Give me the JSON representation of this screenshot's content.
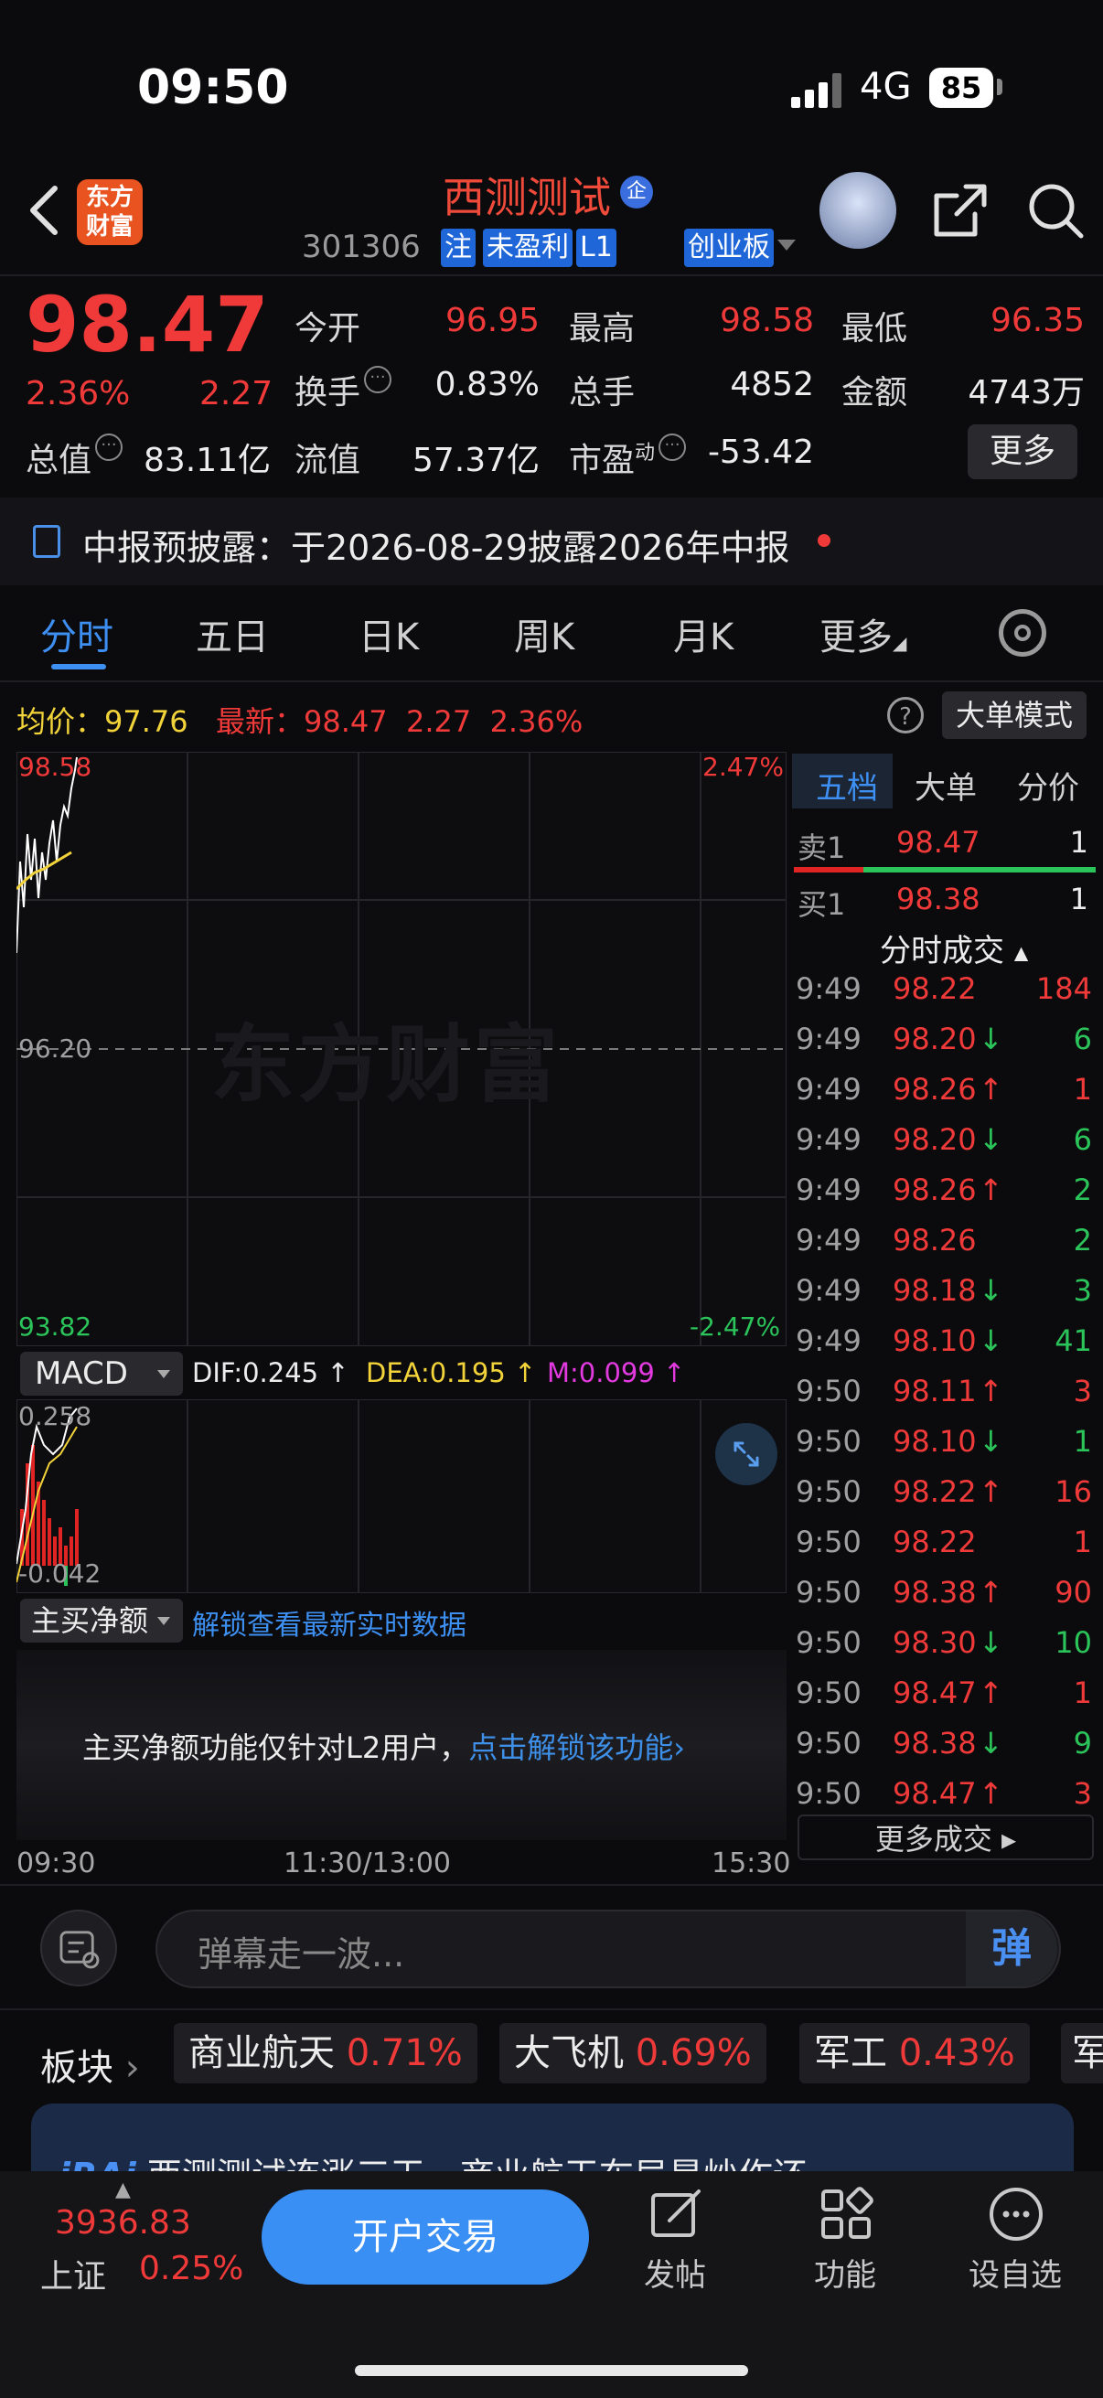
{
  "status": {
    "time": "09:50",
    "network": "4G",
    "battery": "85"
  },
  "header": {
    "logo_line1": "东方",
    "logo_line2": "财富",
    "stock_name": "西测测试",
    "badge": "企",
    "code": "301306",
    "tags": [
      "注",
      "未盈利",
      "L1"
    ],
    "board": "创业板"
  },
  "quote": {
    "price": "98.47",
    "change_pct": "2.36%",
    "change": "2.27",
    "open_label": "今开",
    "open": "96.95",
    "high_label": "最高",
    "high": "98.58",
    "low_label": "最低",
    "low": "96.35",
    "turnover_label": "换手",
    "turnover": "0.83%",
    "volume_label": "总手",
    "volume": "4852",
    "amount_label": "金额",
    "amount": "4743万",
    "mktcap_label": "总值",
    "mktcap": "83.11亿",
    "float_label": "流值",
    "float": "57.37亿",
    "pe_label": "市盈",
    "pe_sup": "动",
    "pe": "-53.42",
    "more": "更多"
  },
  "notice": {
    "text": "中报预披露：于2026-08-29披露2026年中报"
  },
  "tabs": [
    "分时",
    "五日",
    "日K",
    "周K",
    "月K",
    "更多"
  ],
  "chart_info": {
    "avg_label": "均价：",
    "avg": "97.76",
    "latest_label": "最新：",
    "latest": "98.47",
    "latest_chg": "2.27",
    "latest_pct": "2.36%",
    "help": "?",
    "big_order": "大单模式"
  },
  "chart_data": {
    "type": "line",
    "y_max": "98.58",
    "y_mid": "96.20",
    "y_min": "93.82",
    "pct_max": "2.47%",
    "pct_min": "-2.47%",
    "x_labels": [
      "09:30",
      "11:30/13:00",
      "15:30"
    ],
    "watermark": "东方财富",
    "macd": {
      "name": "MACD",
      "dif": "DIF:0.245 ↑",
      "dea": "DEA:0.195 ↑",
      "m": "M:0.099 ↑",
      "top": "0.258",
      "bottom": "-0.042"
    }
  },
  "net_buy": {
    "select": "主买净额",
    "link": "解锁查看最新实时数据",
    "msg": "主买净额功能仅针对L2用户，",
    "msg_link": "点击解锁该功能",
    "msg_chevron": "›"
  },
  "side": {
    "tabs": [
      "五档",
      "大单",
      "分价"
    ],
    "sell_label": "卖1",
    "sell_price": "98.47",
    "sell_vol": "1",
    "buy_label": "买1",
    "buy_price": "98.38",
    "buy_vol": "1",
    "trades_head": "分时成交",
    "trades": [
      {
        "t": "9:49",
        "p": "98.22",
        "d": "",
        "v": "184",
        "c": "red"
      },
      {
        "t": "9:49",
        "p": "98.20",
        "d": "↓",
        "v": "6",
        "c": "green"
      },
      {
        "t": "9:49",
        "p": "98.26",
        "d": "↑",
        "v": "1",
        "c": "red"
      },
      {
        "t": "9:49",
        "p": "98.20",
        "d": "↓",
        "v": "6",
        "c": "green"
      },
      {
        "t": "9:49",
        "p": "98.26",
        "d": "↑",
        "v": "2",
        "c": "green"
      },
      {
        "t": "9:49",
        "p": "98.26",
        "d": "",
        "v": "2",
        "c": "green"
      },
      {
        "t": "9:49",
        "p": "98.18",
        "d": "↓",
        "v": "3",
        "c": "green"
      },
      {
        "t": "9:49",
        "p": "98.10",
        "d": "↓",
        "v": "41",
        "c": "green"
      },
      {
        "t": "9:50",
        "p": "98.11",
        "d": "↑",
        "v": "3",
        "c": "red"
      },
      {
        "t": "9:50",
        "p": "98.10",
        "d": "↓",
        "v": "1",
        "c": "green"
      },
      {
        "t": "9:50",
        "p": "98.22",
        "d": "↑",
        "v": "16",
        "c": "red"
      },
      {
        "t": "9:50",
        "p": "98.22",
        "d": "",
        "v": "1",
        "c": "red"
      },
      {
        "t": "9:50",
        "p": "98.38",
        "d": "↑",
        "v": "90",
        "c": "red"
      },
      {
        "t": "9:50",
        "p": "98.30",
        "d": "↓",
        "v": "10",
        "c": "green"
      },
      {
        "t": "9:50",
        "p": "98.47",
        "d": "↑",
        "v": "1",
        "c": "red"
      },
      {
        "t": "9:50",
        "p": "98.38",
        "d": "↓",
        "v": "9",
        "c": "green"
      },
      {
        "t": "9:50",
        "p": "98.47",
        "d": "↑",
        "v": "3",
        "c": "red"
      }
    ],
    "more_trades": "更多成交 ▸"
  },
  "danmu": {
    "placeholder": "弹幕走一波...",
    "btn": "弹"
  },
  "sectors": {
    "label": "板块",
    "items": [
      {
        "name": "商业航天",
        "pct": "0.71%"
      },
      {
        "name": "大飞机",
        "pct": "0.69%"
      },
      {
        "name": "军工",
        "pct": "0.43%"
      },
      {
        "name": "军",
        "pct": ""
      }
    ]
  },
  "ai_banner": {
    "text": "西测测试连涨三天，商业航天布局是炒作还"
  },
  "bottom": {
    "index_value": "3936.83",
    "index_name": "上证",
    "index_pct": "0.25%",
    "trade_btn": "开户交易",
    "nav": [
      "发帖",
      "功能",
      "设自选"
    ]
  }
}
